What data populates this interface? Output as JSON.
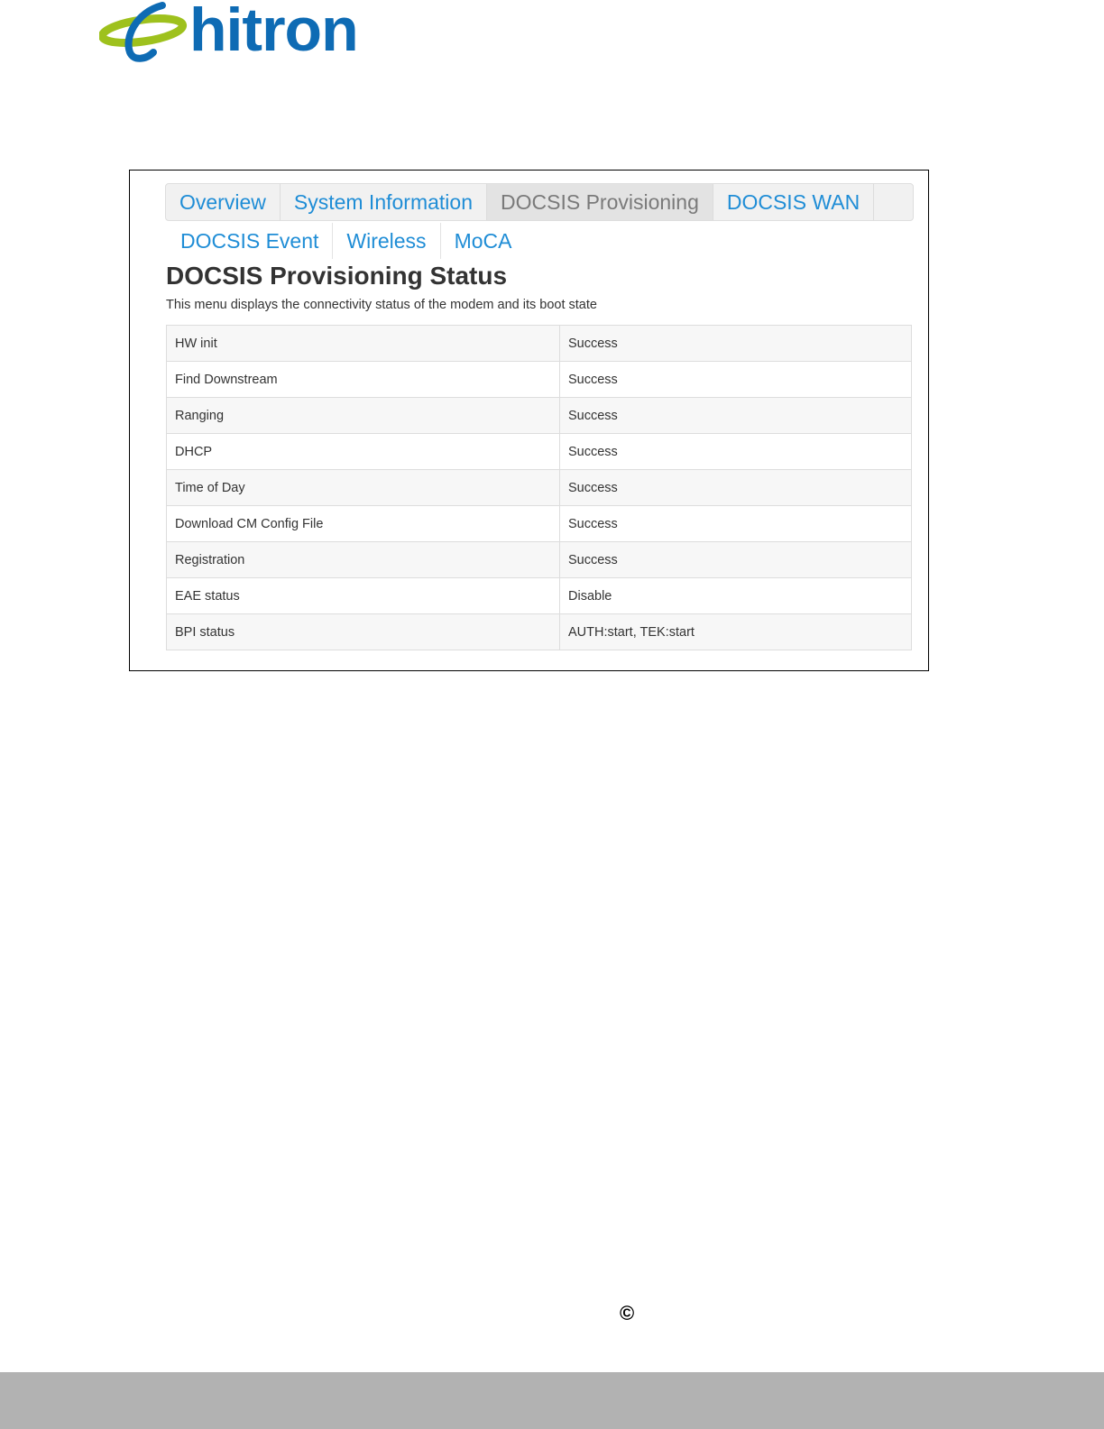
{
  "brand": {
    "name": "hitron",
    "color_blue": "#0e6bb4",
    "color_green": "#9ec11d"
  },
  "tabs_row1": [
    {
      "label": "Overview",
      "active": false
    },
    {
      "label": "System Information",
      "active": false
    },
    {
      "label": "DOCSIS Provisioning",
      "active": true
    },
    {
      "label": "DOCSIS WAN",
      "active": false
    }
  ],
  "tabs_row2": [
    {
      "label": "DOCSIS Event"
    },
    {
      "label": "Wireless"
    },
    {
      "label": "MoCA"
    }
  ],
  "page": {
    "title": "DOCSIS Provisioning Status",
    "subtitle": "This menu displays the connectivity status of the modem and its boot state"
  },
  "status_rows": [
    {
      "label": "HW init",
      "value": "Success"
    },
    {
      "label": "Find Downstream",
      "value": "Success"
    },
    {
      "label": "Ranging",
      "value": "Success"
    },
    {
      "label": "DHCP",
      "value": "Success"
    },
    {
      "label": "Time of Day",
      "value": "Success"
    },
    {
      "label": "Download CM Config File",
      "value": "Success"
    },
    {
      "label": "Registration",
      "value": "Success"
    },
    {
      "label": "EAE status",
      "value": "Disable"
    },
    {
      "label": "BPI status",
      "value": "AUTH:start, TEK:start"
    }
  ],
  "footer": {
    "copyright_symbol": "©"
  }
}
